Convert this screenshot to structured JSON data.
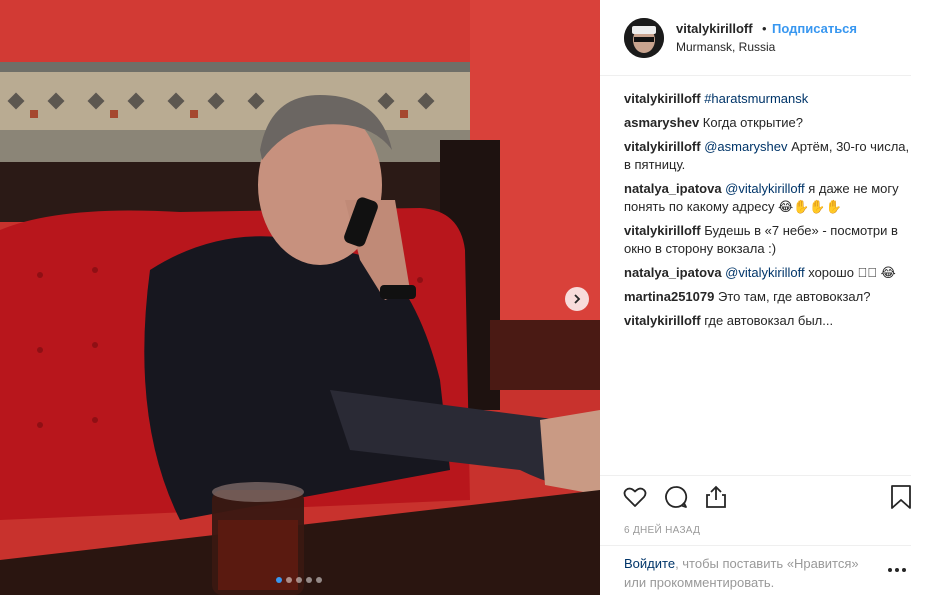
{
  "post": {
    "username": "vitalykirilloff",
    "separator": "•",
    "follow_label": "Подписаться",
    "location": "Murmansk, Russia"
  },
  "comments": [
    {
      "user": "vitalykirilloff",
      "mention": "#haratsmurmansk",
      "text": ""
    },
    {
      "user": "asmaryshev",
      "mention": "",
      "text": "Когда открытие?"
    },
    {
      "user": "vitalykirilloff",
      "mention": "@asmaryshev",
      "text": "Артём, 30-го числа, в пятницу."
    },
    {
      "user": "natalya_ipatova",
      "mention": "@vitalykirilloff",
      "text": "я даже не могу понять по какому адресу 😂✋✋✋"
    },
    {
      "user": "vitalykirilloff",
      "mention": "",
      "text": "Будешь в «7 небе» - посмотри в окно в сторону вокзала :)"
    },
    {
      "user": "natalya_ipatova",
      "mention": "@vitalykirilloff",
      "text": "хорошо 🏻🏻 😂"
    },
    {
      "user": "martina251079",
      "mention": "",
      "text": "Это там, где автовокзал?"
    },
    {
      "user": "vitalykirilloff",
      "mention": "",
      "text": "где автовокзал был..."
    }
  ],
  "time_ago": "6 ДНЕЙ НАЗАД",
  "login": {
    "link": "Войдите",
    "text": ", чтобы поставить «Нравится» или прокомментировать."
  },
  "carousel": {
    "count": 5,
    "active": 0
  },
  "icons": {
    "next": "chevron-right-icon",
    "like": "heart-icon",
    "comment": "comment-bubble-icon",
    "share": "share-upload-icon",
    "save": "bookmark-icon",
    "more": "more-dots-icon"
  },
  "colors": {
    "accent": "#3897f0",
    "link": "#003569",
    "muted": "#999999"
  }
}
